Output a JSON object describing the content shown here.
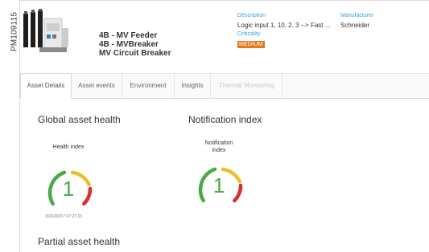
{
  "side_code": "PM109115",
  "asset": {
    "name_lines": [
      "4B - MV Feeder",
      "4B - MVBreaker",
      "MV Circuit Breaker"
    ],
    "description_label": "Description",
    "description_value": "Logic input 1, 10, 2, 3 --> Fast ...",
    "manufacturer_label": "Manufacturer",
    "manufacturer_value": "Schneider",
    "criticality_label": "Criticality",
    "criticality_value": "MEDIUM"
  },
  "tabs": [
    {
      "label": "Asset Details",
      "state": "active"
    },
    {
      "label": "Asset events",
      "state": "normal"
    },
    {
      "label": "Environment",
      "state": "normal"
    },
    {
      "label": "Insights",
      "state": "normal"
    },
    {
      "label": "Thermal Monitoring",
      "state": "disabled"
    }
  ],
  "global_health": {
    "title": "Global asset health",
    "gauge_label": "Health index",
    "value": "1",
    "timestamp": "2021/03/17 07:27:33"
  },
  "notification": {
    "title": "Notification index",
    "gauge_label_line1": "Notification",
    "gauge_label_line2": "index",
    "value": "1"
  },
  "partial_health": {
    "title": "Partial asset health"
  },
  "colors": {
    "green": "#4aaa45",
    "yellow": "#e6c229",
    "red": "#d6302a",
    "accent_blue": "#3aa0d8",
    "badge_orange": "#e27a1f"
  }
}
